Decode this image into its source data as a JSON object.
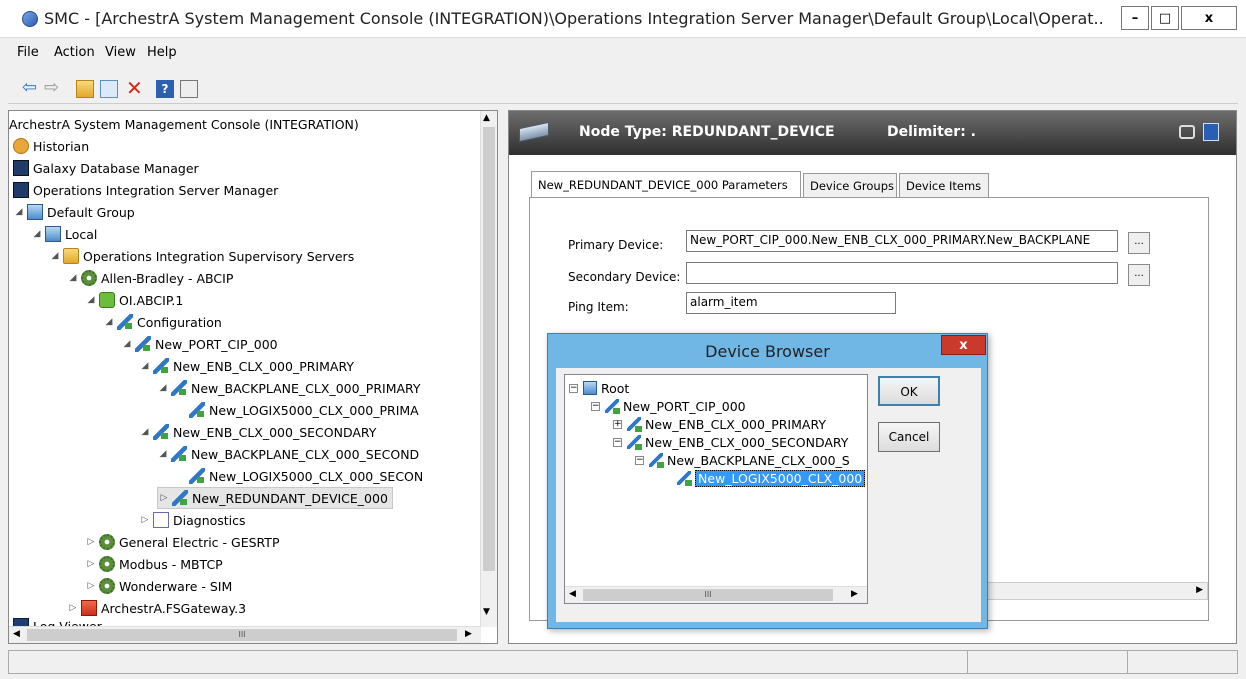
{
  "window": {
    "title": "SMC - [ArchestrA System Management Console (INTEGRATION)\\Operations Integration Server Manager\\Default Group\\Local\\Operat...",
    "minimize": "–",
    "maximize": "□",
    "close": "x"
  },
  "menu": [
    "File",
    "Action",
    "View",
    "Help"
  ],
  "tree": [
    {
      "label": "ArchestrA System Management Console (INTEGRATION)",
      "icon": ""
    },
    {
      "label": "Historian",
      "icon": "historian-icon"
    },
    {
      "label": "Galaxy Database Manager",
      "icon": "database-icon"
    },
    {
      "label": "Operations Integration Server Manager",
      "icon": "server-manager-icon"
    },
    {
      "label": "Default Group",
      "icon": "group-icon"
    },
    {
      "label": "Local",
      "icon": "computer-icon"
    },
    {
      "label": "Operations Integration Supervisory Servers",
      "icon": "folder-icon"
    },
    {
      "label": "Allen-Bradley - ABCIP",
      "icon": "gear-icon"
    },
    {
      "label": "OI.ABCIP.1",
      "icon": "oi-server-icon"
    },
    {
      "label": "Configuration",
      "icon": "configuration-icon"
    },
    {
      "label": "New_PORT_CIP_000",
      "icon": "device-icon"
    },
    {
      "label": "New_ENB_CLX_000_PRIMARY",
      "icon": "device-icon"
    },
    {
      "label": "New_BACKPLANE_CLX_000_PRIMARY",
      "icon": "device-icon"
    },
    {
      "label": "New_LOGIX5000_CLX_000_PRIMA",
      "icon": "device-icon"
    },
    {
      "label": "New_ENB_CLX_000_SECONDARY",
      "icon": "device-icon"
    },
    {
      "label": "New_BACKPLANE_CLX_000_SECOND",
      "icon": "device-icon"
    },
    {
      "label": "New_LOGIX5000_CLX_000_SECON",
      "icon": "device-icon"
    },
    {
      "label": "New_REDUNDANT_DEVICE_000",
      "icon": "device-icon"
    },
    {
      "label": "Diagnostics",
      "icon": "diagnostics-icon"
    },
    {
      "label": "General Electric - GESRTP",
      "icon": "gear-icon"
    },
    {
      "label": "Modbus - MBTCP",
      "icon": "gear-icon"
    },
    {
      "label": "Wonderware - SIM",
      "icon": "gear-icon"
    },
    {
      "label": "ArchestrA.FSGateway.3",
      "icon": "fsgateway-icon"
    },
    {
      "label": "Log Viewer",
      "icon": "log-viewer-icon"
    }
  ],
  "hscroll_label": "III",
  "right": {
    "node_type": "Node Type: REDUNDANT_DEVICE",
    "delimiter": "Delimiter: .",
    "tabs": [
      "New_REDUNDANT_DEVICE_000 Parameters",
      "Device Groups",
      "Device Items"
    ],
    "primary_label": "Primary Device:",
    "primary_value": "New_PORT_CIP_000.New_ENB_CLX_000_PRIMARY.New_BACKPLANE",
    "secondary_label": "Secondary Device:",
    "secondary_value": "",
    "ping_label": "Ping Item:",
    "ping_value": "alarm_item",
    "browse": "..."
  },
  "dialog": {
    "title": "Device Browser",
    "close": "x",
    "ok": "OK",
    "cancel": "Cancel",
    "hscroll_label": "III",
    "tree": [
      {
        "label": "Root",
        "sign": "−"
      },
      {
        "label": "New_PORT_CIP_000",
        "sign": "−"
      },
      {
        "label": "New_ENB_CLX_000_PRIMARY",
        "sign": "+"
      },
      {
        "label": "New_ENB_CLX_000_SECONDARY",
        "sign": "−"
      },
      {
        "label": "New_BACKPLANE_CLX_000_S",
        "sign": "−"
      },
      {
        "label": "New_LOGIX5000_CLX_000",
        "sign": ""
      }
    ]
  }
}
